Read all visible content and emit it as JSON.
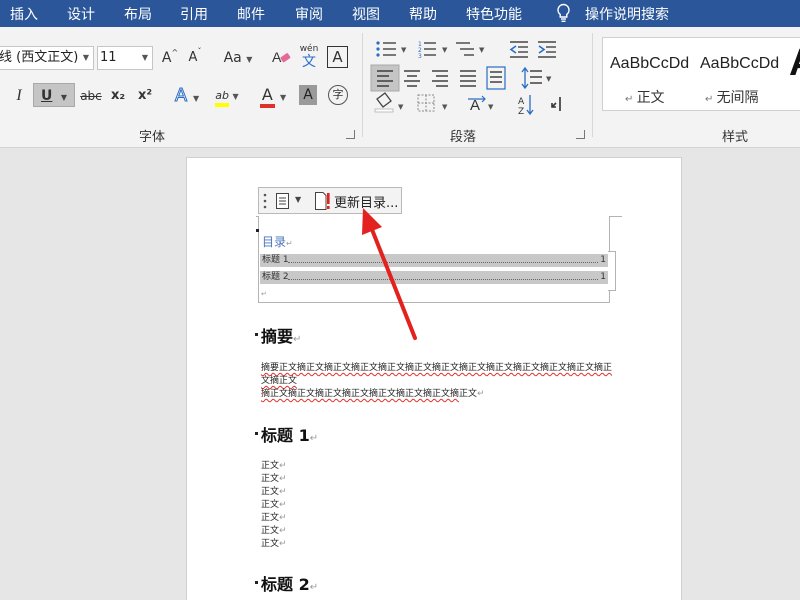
{
  "ribbon_tabs": [
    "插入",
    "设计",
    "布局",
    "引用",
    "邮件",
    "审阅",
    "视图",
    "帮助",
    "特色功能"
  ],
  "tell_me": "操作说明搜索",
  "font": {
    "name": "线 (西文正文)",
    "size": "11",
    "grow": "A",
    "shrink": "A",
    "change_case": "Aa",
    "phonetic": "wén",
    "phonetic_char": "文",
    "border_char": "A",
    "italic": "I",
    "underline": "U",
    "strike": "abc",
    "subscript": "x₂",
    "superscript": "x²",
    "effects": "A",
    "highlight": "ab",
    "font_color": "A",
    "shade": "A",
    "enclose": "字",
    "group_label": "字体"
  },
  "paragraph": {
    "group_label": "段落"
  },
  "styles": {
    "items": [
      {
        "sample": "AaBbCcDd",
        "name": "正文"
      },
      {
        "sample": "AaBbCcDd",
        "name": "无间隔"
      }
    ],
    "big_sample": "A",
    "group_label": "样式"
  },
  "toc_toolbar": {
    "update_label": "更新目录..."
  },
  "toc": {
    "title": "目录",
    "entries": [
      {
        "text": "标题 1",
        "page": "1"
      },
      {
        "text": "标题 2",
        "page": "1"
      }
    ]
  },
  "document": {
    "abstract_heading": "摘要",
    "abstract_text_line1": "摘要正文摘正文摘正文摘正文摘正文摘正文摘正文摘正文摘正文摘正文摘正文摘正文摘正文摘正文",
    "abstract_text_line2": "摘正文摘正文摘正文摘正文摘正文摘正文摘正文摘",
    "abstract_tail": "正文",
    "heading1": "标题 1",
    "body_lines": [
      "正文",
      "正文",
      "正文",
      "正文",
      "正文",
      "正文",
      "正文"
    ],
    "heading2": "标题 2"
  },
  "colors": {
    "ribbon_blue": "#2b579a",
    "highlight_yellow": "#ffff00",
    "font_red": "#e0302b",
    "arrow_red": "#e3211e"
  }
}
